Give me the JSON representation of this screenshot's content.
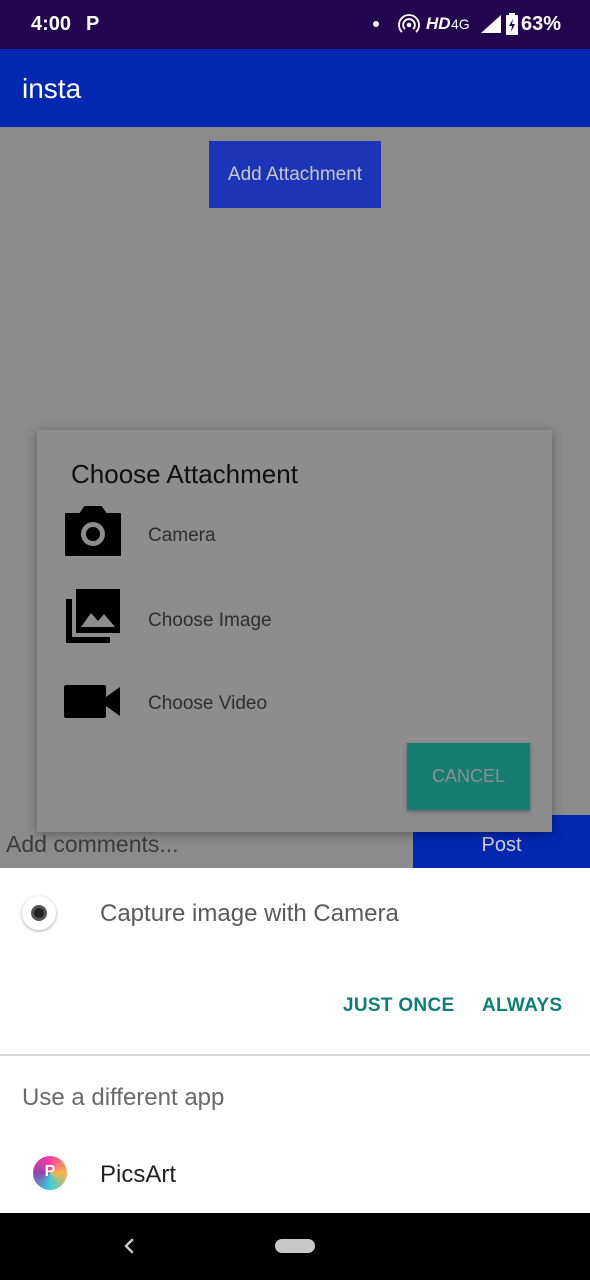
{
  "status_bar": {
    "time": "4:00",
    "notification_icon": "P",
    "hd": "HD",
    "network": "4G",
    "battery": "63%"
  },
  "app_bar": {
    "title": "insta"
  },
  "main": {
    "add_attachment": "Add Attachment",
    "comment_placeholder": "Add comments...",
    "post": "Post"
  },
  "dialog": {
    "title": "Choose Attachment",
    "items": [
      {
        "icon": "camera-icon",
        "label": "Camera"
      },
      {
        "icon": "photo-library-icon",
        "label": "Choose Image"
      },
      {
        "icon": "videocam-icon",
        "label": "Choose Video"
      }
    ],
    "cancel": "CANCEL"
  },
  "sheet": {
    "title": "Capture image with Camera",
    "just_once": "JUST ONCE",
    "always": "ALWAYS",
    "different_app": "Use a different app",
    "apps": [
      {
        "icon": "picsart-icon",
        "label": "PicsArt"
      }
    ]
  },
  "colors": {
    "status_bar": "#24054f",
    "app_bar": "#0228b2",
    "accent_teal": "#0e7f73",
    "cancel_button": "#177c72"
  }
}
